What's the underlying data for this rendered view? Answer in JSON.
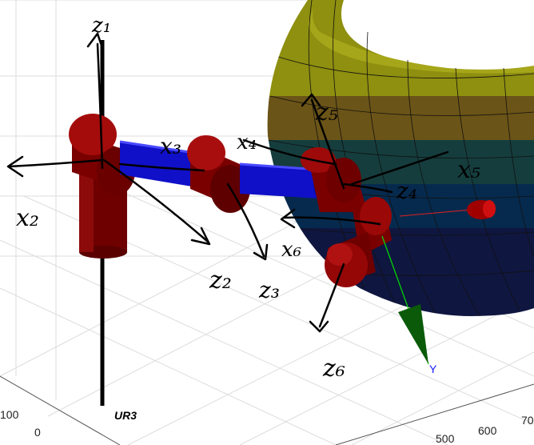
{
  "robot": {
    "name": "UR3",
    "colors": {
      "joint": "#8b0000",
      "link": "#1010c8",
      "base_pole": "#000000",
      "axis_y": "#0a5a0a",
      "axis_y_label": "#1a1aff"
    }
  },
  "axis_labels": {
    "y_arrow": "Y"
  },
  "annotations": {
    "z1": "z₁",
    "x2": "x₂",
    "z2": "z₂",
    "x3": "x₃",
    "z3": "z₃",
    "x4": "x₄",
    "z4": "z₄",
    "x5": "x₅",
    "z5": "z₅",
    "x6": "x₆",
    "z6": "z₆"
  },
  "ticks": {
    "t100": "100",
    "t0": "0",
    "t500": "500",
    "t600": "600",
    "t700": "70"
  },
  "sphere": {
    "bands": [
      "#8f8f10",
      "#6b5417",
      "#153d3d",
      "#062a4e",
      "#0f1640"
    ]
  }
}
